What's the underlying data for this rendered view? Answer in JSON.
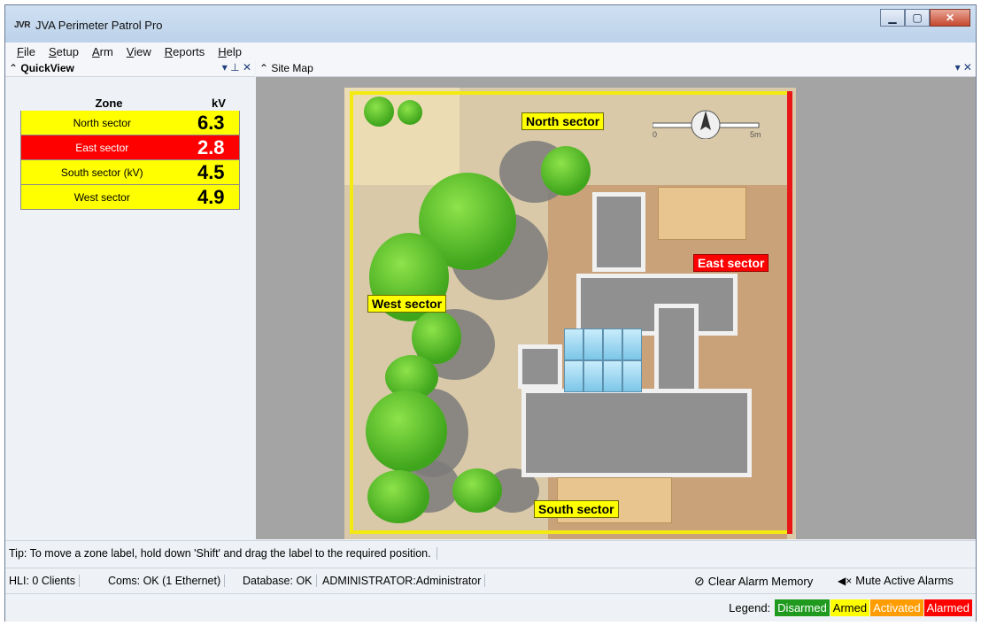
{
  "window": {
    "app_icon": "JVR",
    "title": "JVA Perimeter Patrol Pro",
    "minimize_icon": "minimize-icon",
    "maximize_icon": "maximize-icon",
    "close_icon": "close-icon"
  },
  "menu": [
    {
      "label": "File",
      "accel": "F",
      "rest": "ile"
    },
    {
      "label": "Setup",
      "accel": "S",
      "rest": "etup"
    },
    {
      "label": "Arm",
      "accel": "A",
      "rest": "rm"
    },
    {
      "label": "View",
      "accel": "V",
      "rest": "iew"
    },
    {
      "label": "Reports",
      "accel": "R",
      "rest": "eports"
    },
    {
      "label": "Help",
      "accel": "H",
      "rest": "elp"
    }
  ],
  "quickview": {
    "caption": "QuickView",
    "tools": "▾ ⊥ ✕",
    "col_zone": "Zone",
    "col_kv": "kV",
    "zones": [
      {
        "name": "North sector",
        "kv": "6.3",
        "bg": "#ffff00",
        "fg": "#000000"
      },
      {
        "name": "East sector",
        "kv": "2.8",
        "bg": "#ff0000",
        "fg": "#ffffff"
      },
      {
        "name": "South sector  (kV)",
        "kv": "4.5",
        "bg": "#ffff00",
        "fg": "#000000"
      },
      {
        "name": "West sector",
        "kv": "4.9",
        "bg": "#ffff00",
        "fg": "#000000"
      }
    ]
  },
  "sitemap": {
    "caption": "Site Map",
    "tools": "▾ ✕",
    "labels": {
      "north": "North sector",
      "east": "East sector",
      "south": "South sector",
      "west": "West sector"
    },
    "scale_start": "0",
    "scale_end": "5m"
  },
  "status": {
    "tip": "Tip: To move a zone label, hold down 'Shift' and drag the label to the required position.",
    "hli": "HLI: 0 Clients",
    "coms": "Coms: OK (1 Ethernet)",
    "database": "Database: OK",
    "user": "ADMINISTRATOR:Administrator",
    "clear_alarm": "Clear Alarm Memory",
    "mute_alarms": "Mute Active Alarms"
  },
  "legend": {
    "label": "Legend:",
    "items": [
      {
        "text": "Disarmed",
        "bg": "#1f9a1f",
        "fg": "#ffffff"
      },
      {
        "text": "Armed",
        "bg": "#ffff00",
        "fg": "#000000"
      },
      {
        "text": "Activated",
        "bg": "#ff9c00",
        "fg": "#ffffff"
      },
      {
        "text": "Alarmed",
        "bg": "#ff0000",
        "fg": "#ffffff"
      }
    ]
  }
}
